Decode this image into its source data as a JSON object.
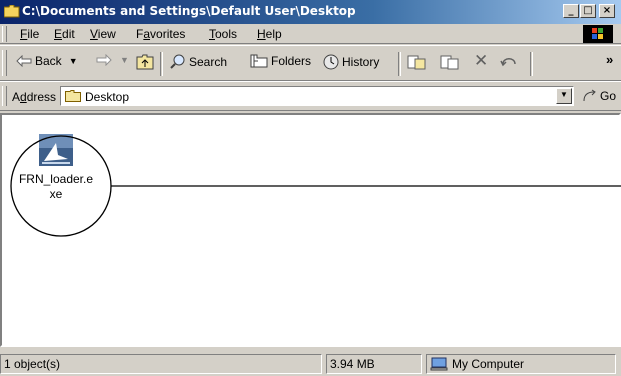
{
  "window": {
    "title": "C:\\Documents and Settings\\Default User\\Desktop",
    "minimize_glyph": "_",
    "maximize_glyph": "□",
    "close_glyph": "×"
  },
  "menu": {
    "items": [
      {
        "label": "File",
        "accel": "F",
        "rest": "ile"
      },
      {
        "label": "Edit",
        "accel": "E",
        "rest": "dit"
      },
      {
        "label": "View",
        "accel": "V",
        "rest": "iew"
      },
      {
        "label": "Favorites",
        "pre": "F",
        "accel": "a",
        "rest": "vorites"
      },
      {
        "label": "Tools",
        "accel": "T",
        "rest": "ools"
      },
      {
        "label": "Help",
        "accel": "H",
        "rest": "elp"
      }
    ]
  },
  "toolbar": {
    "back_label": "Back",
    "search_label": "Search",
    "folders_label": "Folders",
    "history_label": "History",
    "more_glyph": "»"
  },
  "address": {
    "label_pre": "A",
    "label_accel": "d",
    "label_rest": "dress",
    "value": "Desktop",
    "go_label": "Go"
  },
  "content": {
    "file_name": "FRN_loader.exe",
    "file_icon": "setup-exe-icon"
  },
  "status": {
    "objects": "1 object(s)",
    "size": "3.94 MB",
    "zone": "My Computer"
  },
  "colors": {
    "titlebar_start": "#0a246a",
    "titlebar_end": "#a6caf0",
    "chrome": "#d4d0c8"
  }
}
